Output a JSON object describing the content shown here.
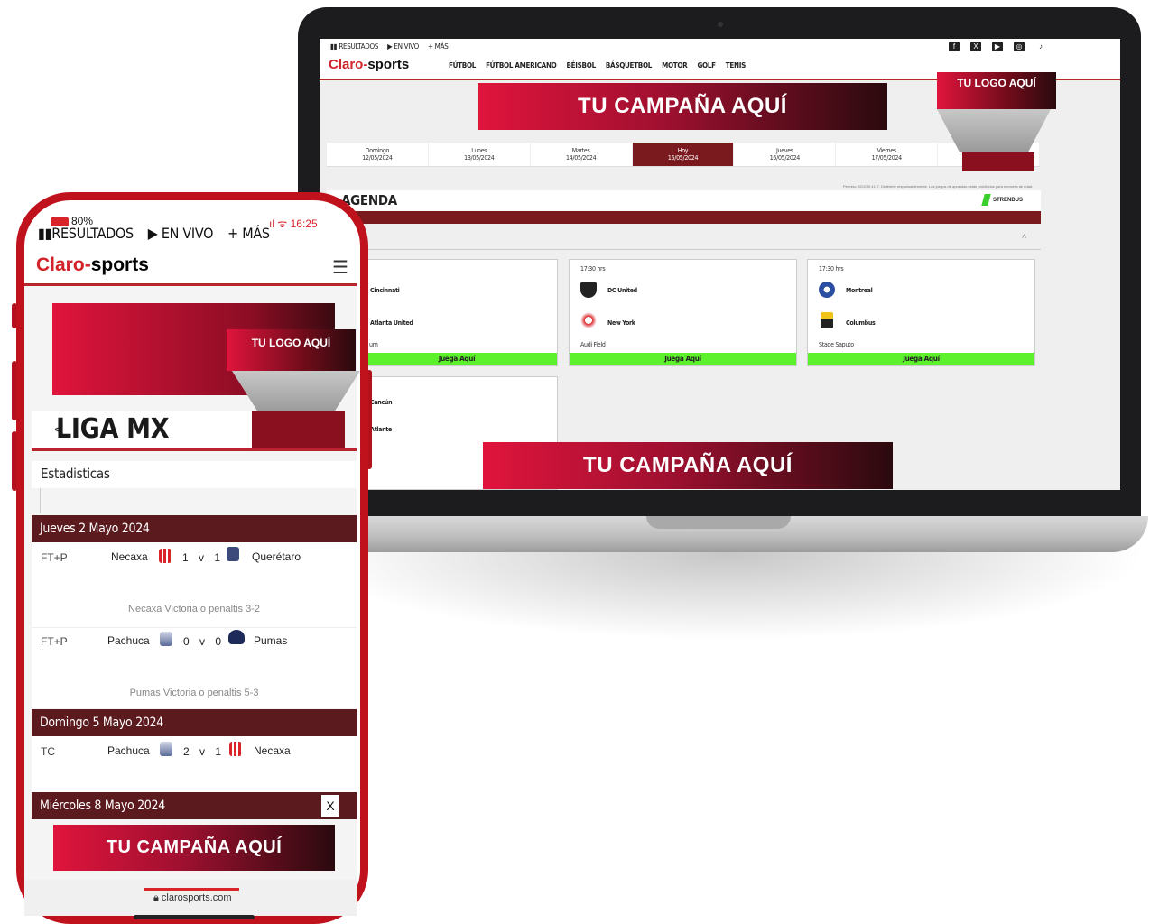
{
  "desktop": {
    "util": [
      "RESULTADOS",
      "EN VIVO",
      "MÁS"
    ],
    "logo_claro": "Claro",
    "logo_sports": "sports",
    "nav": [
      "FÚTBOL",
      "FÚTBOL AMERICANO",
      "BÉISBOL",
      "BÁSQUETBOL",
      "MOTOR",
      "GOLF",
      "TENIS"
    ],
    "campaign_top": "TU CAMPAÑA AQUÍ",
    "campaign_bottom": "TU CAMPAÑA AQUÍ",
    "logo_ad": "TU LOGO AQUÍ",
    "days": [
      {
        "name": "Domingo",
        "date": "12/05/2024"
      },
      {
        "name": "Lunes",
        "date": "13/05/2024"
      },
      {
        "name": "Martes",
        "date": "14/05/2024"
      },
      {
        "name": "Hoy",
        "date": "15/05/2024"
      },
      {
        "name": "Jueves",
        "date": "16/05/2024"
      },
      {
        "name": "Viernes",
        "date": "17/05/2024"
      }
    ],
    "agenda_title": "AGENDA",
    "agenda_note": "Permiso SEGOB 4117. Diviértete responsablemente. Los juegos de apuestas están prohibidos para menores de edad.",
    "sponsor": "STRENDUS",
    "matches": [
      {
        "time": "",
        "home": "Cincinnati",
        "away": "Atlanta United",
        "venue": "um",
        "cta": "Juega Aquí"
      },
      {
        "time": "17:30 hrs",
        "home": "DC United",
        "away": "New York",
        "venue": "Audi Field",
        "cta": "Juega Aquí"
      },
      {
        "time": "17:30 hrs",
        "home": "Montreal",
        "away": "Columbus",
        "venue": "Stade Saputo",
        "cta": "Juega Aquí"
      },
      {
        "time": "",
        "home": "Cancún",
        "away": "Atlante",
        "venue": "",
        "cta": ""
      }
    ]
  },
  "mobile": {
    "battery": "80%",
    "time": "16:25",
    "util": [
      "RESULTADOS",
      "EN VIVO",
      "MÁS"
    ],
    "logo_claro": "Claro",
    "logo_sports": "sports",
    "logo_ad": "TU LOGO AQUÍ",
    "league": "LIGA MX",
    "stats_label": "Estadisticas",
    "dates": [
      "Jueves 2 Mayo 2024",
      "Domingo 5 Mayo 2024",
      "Miércoles 8 Mayo 2024"
    ],
    "games": [
      {
        "code": "FT+P",
        "home": "Necaxa",
        "score": "1 v 1",
        "away": "Querétaro",
        "note": "Necaxa Victoria o penaltis 3-2"
      },
      {
        "code": "FT+P",
        "home": "Pachuca",
        "score": "0 v 0",
        "away": "Pumas",
        "note": "Pumas Victoria o penaltis 5-3"
      },
      {
        "code": "TC",
        "home": "Pachuca",
        "score": "2 v 1",
        "away": "Necaxa",
        "note": ""
      }
    ],
    "close": "X",
    "campaign": "TU CAMPAÑA AQUÍ",
    "url": "clarosports.com",
    "colors": {
      "brand_red": "#c0121c",
      "dark_red": "#5b1a1d",
      "play_green": "#5cf02d"
    }
  }
}
